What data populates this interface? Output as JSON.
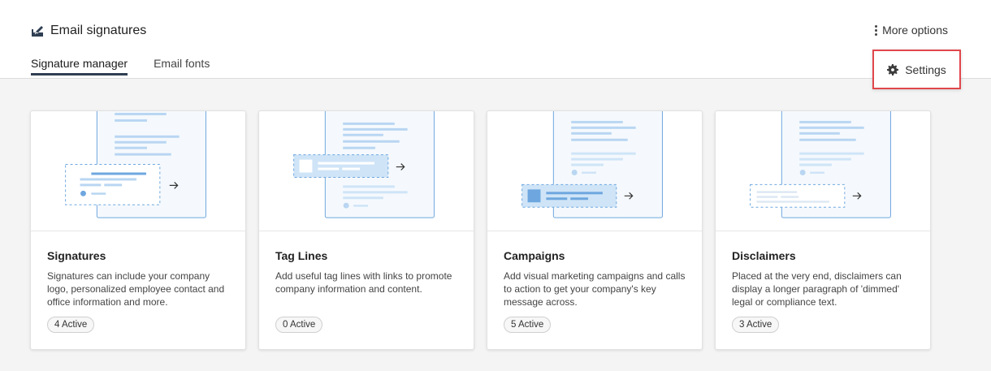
{
  "header": {
    "title": "Email signatures",
    "icon": "signature-pen-icon",
    "more_options_label": "More options",
    "settings_label": "Settings"
  },
  "tabs": [
    {
      "label": "Signature manager",
      "active": true
    },
    {
      "label": "Email fonts",
      "active": false
    }
  ],
  "cards": [
    {
      "title": "Signatures",
      "description": "Signatures can include your company logo, personalized employee contact and office information and more.",
      "badge": "4 Active"
    },
    {
      "title": "Tag Lines",
      "description": "Add useful tag lines with links to promote company information and content.",
      "badge": "0 Active"
    },
    {
      "title": "Campaigns",
      "description": "Add visual marketing campaigns and calls to action to get your company's key message across.",
      "badge": "5 Active"
    },
    {
      "title": "Disclaimers",
      "description": "Placed at the very end, disclaimers can display a longer paragraph of 'dimmed' legal or compliance text.",
      "badge": "3 Active"
    }
  ],
  "colors": {
    "highlight_border": "#e0474c",
    "tab_underline": "#2f3e52",
    "illustration_blue": "#4a90d9",
    "illustration_light": "#cfe4f7"
  }
}
